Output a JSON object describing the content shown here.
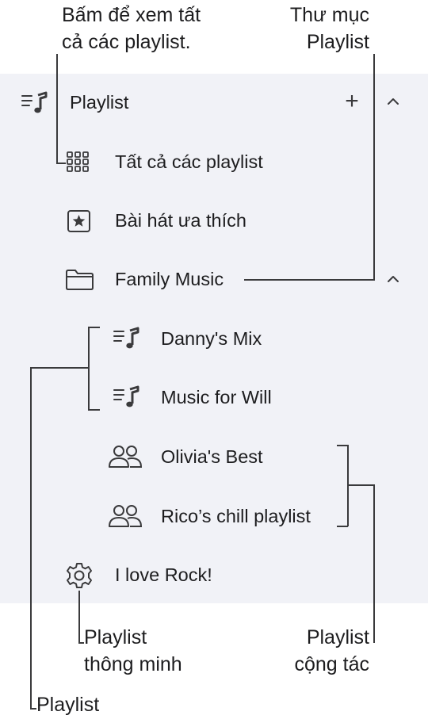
{
  "callouts": {
    "all_playlists": [
      "Bấm để xem tất",
      "cả các playlist."
    ],
    "playlist_folder": [
      "Thư mục",
      "Playlist"
    ],
    "smart_playlist": [
      "Playlist",
      "thông minh"
    ],
    "collab_playlist": [
      "Playlist",
      "cộng tác"
    ],
    "playlist": "Playlist"
  },
  "sidebar": {
    "section_title": "Playlist",
    "add_symbol": "+",
    "items": [
      {
        "label": "Tất cả các playlist",
        "icon": "grid-icon"
      },
      {
        "label": "Bài hát ưa thích",
        "icon": "star-box-icon"
      },
      {
        "label": "Family Music",
        "icon": "folder-icon"
      },
      {
        "label": "Danny's Mix",
        "icon": "playlist-icon"
      },
      {
        "label": "Music for Will",
        "icon": "playlist-icon"
      },
      {
        "label": "Olivia's Best",
        "icon": "people-icon"
      },
      {
        "label": "Rico’s chill playlist",
        "icon": "people-icon"
      },
      {
        "label": "I love Rock!",
        "icon": "gear-icon"
      }
    ]
  },
  "colors": {
    "panel_bg": "#f1f2f7",
    "text": "#1d1d1f",
    "icon": "#3a3a3c",
    "line": "#3a3a3c"
  }
}
